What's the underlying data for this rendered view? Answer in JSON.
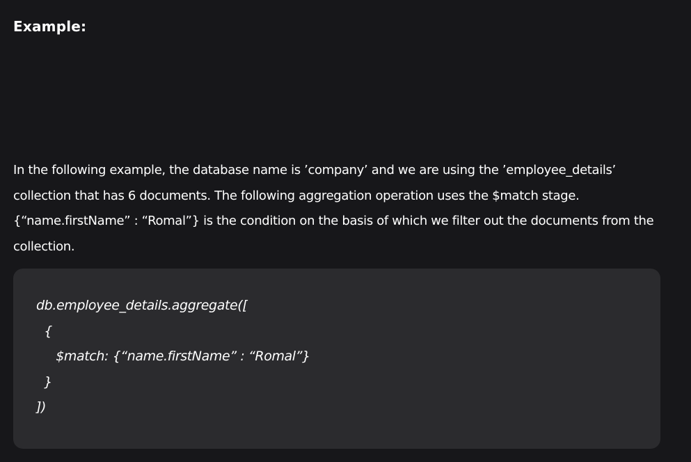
{
  "section": {
    "heading": "Example:",
    "paragraph": "In the following example, the database name is ’company’ and we are using the ’employee_details’ collection that has 6 documents. The following aggregation operation uses the $match stage. {“name.firstName” : “Romal”} is the condition on the basis of which we filter out the documents from the collection."
  },
  "code": {
    "lines": [
      "db.employee_details.aggregate([",
      "  {",
      "     $match: {“name.firstName” : “Romal”}",
      "  }",
      "])"
    ]
  }
}
